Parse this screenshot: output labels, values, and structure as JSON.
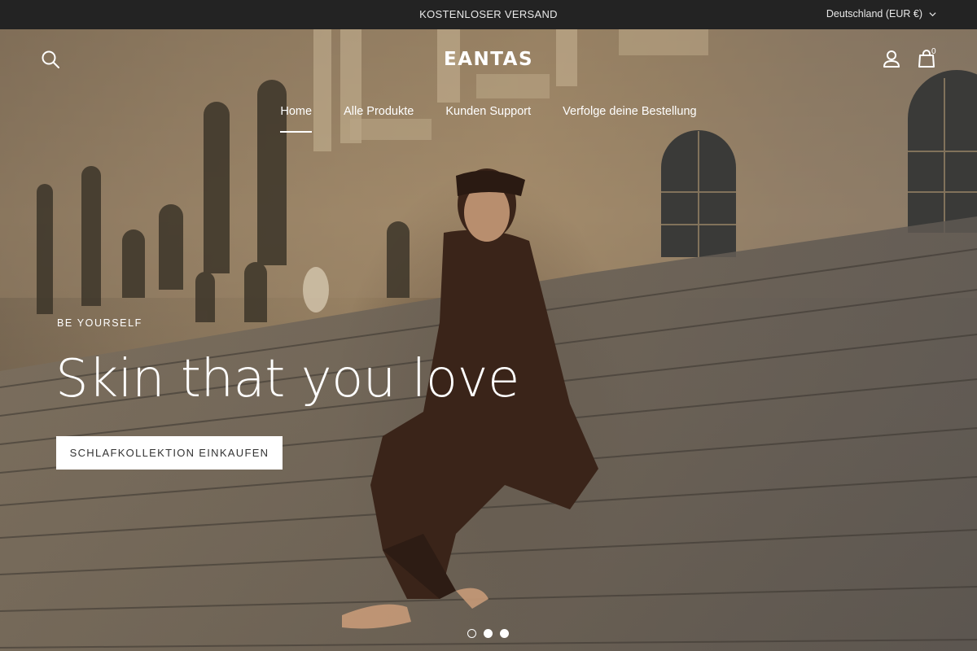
{
  "topbar": {
    "announcement": "KOSTENLOSER VERSAND",
    "locale": "Deutschland (EUR €)"
  },
  "header": {
    "logo": "EANTAS",
    "cart_count": "0"
  },
  "nav": {
    "items": [
      {
        "label": "Home",
        "active": true
      },
      {
        "label": "Alle Produkte",
        "active": false
      },
      {
        "label": "Kunden Support",
        "active": false
      },
      {
        "label": "Verfolge deine Bestellung",
        "active": false
      }
    ]
  },
  "hero": {
    "eyebrow": "BE YOURSELF",
    "headline": "Skin that you love",
    "cta": "SCHLAFKOLLEKTION EINKAUFEN",
    "slides": 3,
    "active_slide": 1
  },
  "icons": {
    "search": "search-icon",
    "account": "user-icon",
    "cart": "shopping-bag-icon",
    "locale_caret": "chevron-down-icon"
  }
}
